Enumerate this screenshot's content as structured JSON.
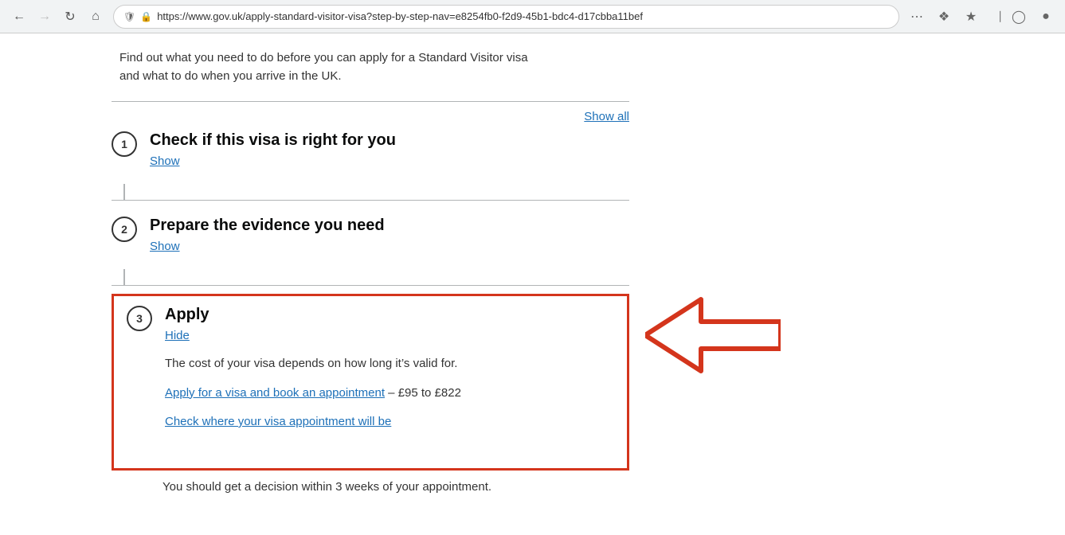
{
  "browser": {
    "url": "https://www.gov.uk/apply-standard-visitor-visa?step-by-step-nav=e8254fb0-f2d9-45b1-bdc4-d17cbba11bef",
    "shield_icon": "🛡",
    "lock_icon": "🔒"
  },
  "page": {
    "intro_text_1": "Find out what you need to do before you can apply for a Standard Visitor visa",
    "intro_text_2": "and what to do when you arrive in the UK.",
    "show_all_label": "Show all",
    "steps": [
      {
        "number": "1",
        "title": "Check if this visa is right for you",
        "toggle": "Show",
        "expanded": false
      },
      {
        "number": "2",
        "title": "Prepare the evidence you need",
        "toggle": "Show",
        "expanded": false
      },
      {
        "number": "3",
        "title": "Apply",
        "toggle": "Hide",
        "expanded": true,
        "highlighted": true,
        "body_text": "The cost of your visa depends on how long it’s valid for.",
        "links": [
          {
            "text": "Apply for a visa and book an appointment",
            "suffix": " – £95 to £822"
          },
          {
            "text": "Check where your visa appointment will be",
            "suffix": ""
          }
        ],
        "footer_text": "You should get a decision within 3 weeks of your appointment."
      }
    ]
  }
}
